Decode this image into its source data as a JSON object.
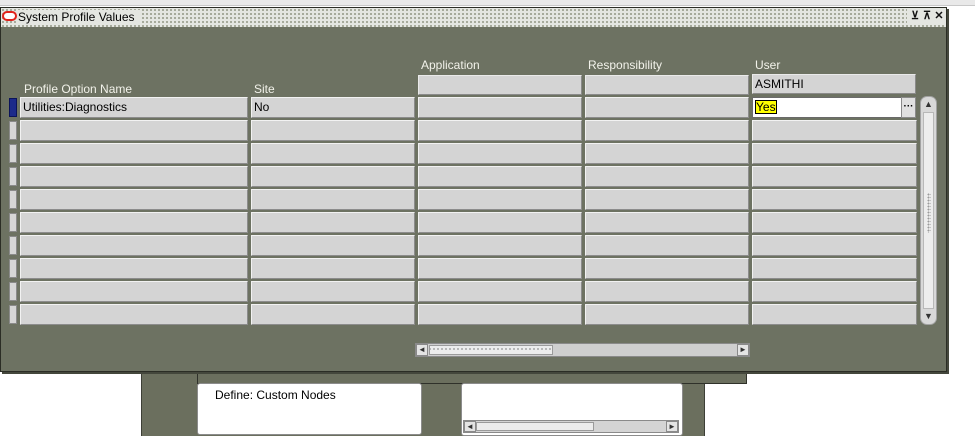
{
  "window": {
    "title": "System Profile Values",
    "controls": {
      "minimize": "⊻",
      "maximize": "⊼",
      "close": "✕"
    }
  },
  "columns": {
    "profile_option": "Profile Option Name",
    "site": "Site",
    "application": "Application",
    "responsibility": "Responsibility",
    "user": "User"
  },
  "header_values": {
    "application": "",
    "responsibility": "",
    "user": "ASMITHI"
  },
  "rows": [
    {
      "profile_option": "Utilities:Diagnostics",
      "site": "No",
      "application": "",
      "responsibility": "",
      "user": "Yes"
    },
    {
      "profile_option": "",
      "site": "",
      "application": "",
      "responsibility": "",
      "user": ""
    },
    {
      "profile_option": "",
      "site": "",
      "application": "",
      "responsibility": "",
      "user": ""
    },
    {
      "profile_option": "",
      "site": "",
      "application": "",
      "responsibility": "",
      "user": ""
    },
    {
      "profile_option": "",
      "site": "",
      "application": "",
      "responsibility": "",
      "user": ""
    },
    {
      "profile_option": "",
      "site": "",
      "application": "",
      "responsibility": "",
      "user": ""
    },
    {
      "profile_option": "",
      "site": "",
      "application": "",
      "responsibility": "",
      "user": ""
    },
    {
      "profile_option": "",
      "site": "",
      "application": "",
      "responsibility": "",
      "user": ""
    },
    {
      "profile_option": "",
      "site": "",
      "application": "",
      "responsibility": "",
      "user": ""
    },
    {
      "profile_option": "",
      "site": "",
      "application": "",
      "responsibility": "",
      "user": ""
    }
  ],
  "lov_button": "···",
  "background_window": {
    "panel_text": "Define: Custom Nodes"
  },
  "scroll_arrows": {
    "left": "◄",
    "right": "►",
    "up": "▲",
    "down": "▼"
  },
  "colors": {
    "window_bg": "#6d7262",
    "field_bg": "#d4d4d4",
    "highlight": "#ffff00",
    "active_indicator": "#1c2a8a",
    "oracle_red": "#e0231b"
  },
  "icons": {
    "logo": "oracle-logo-icon",
    "minimize": "minimize-icon",
    "maximize": "maximize-icon",
    "close": "close-icon"
  }
}
